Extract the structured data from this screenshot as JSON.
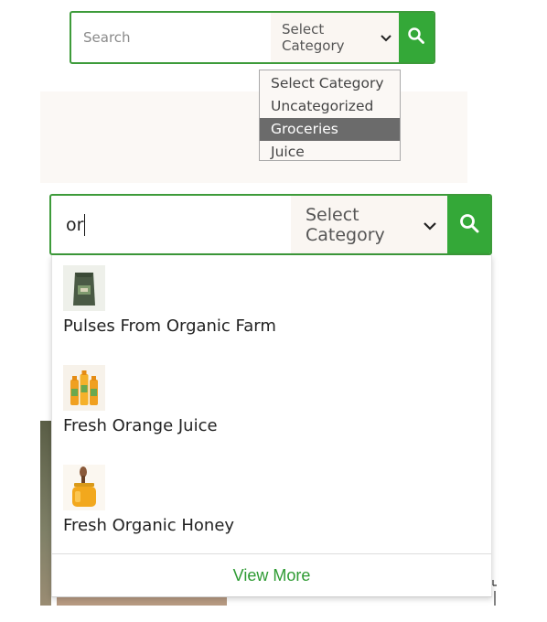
{
  "top_search": {
    "placeholder": "Search",
    "category_label": "Select Category"
  },
  "category_dropdown": {
    "options": [
      "Select Category",
      "Uncategorized",
      "Groceries",
      "Juice"
    ],
    "highlighted": "Groceries"
  },
  "main_search": {
    "query": "or",
    "category_label": "Select Category"
  },
  "results": [
    {
      "name": "Pulses From Organic Farm",
      "icon": "pulses-bag-thumbnail"
    },
    {
      "name": "Fresh Orange Juice",
      "icon": "orange-juice-bottles-thumbnail"
    },
    {
      "name": "Fresh Organic Honey",
      "icon": "honey-jar-thumbnail"
    }
  ],
  "view_more_label": "View More",
  "colors": {
    "accent_green": "#34a838",
    "border_green": "#3d9b3a",
    "link_green": "#2e9b33",
    "highlight_gray": "#6b6b6b"
  }
}
